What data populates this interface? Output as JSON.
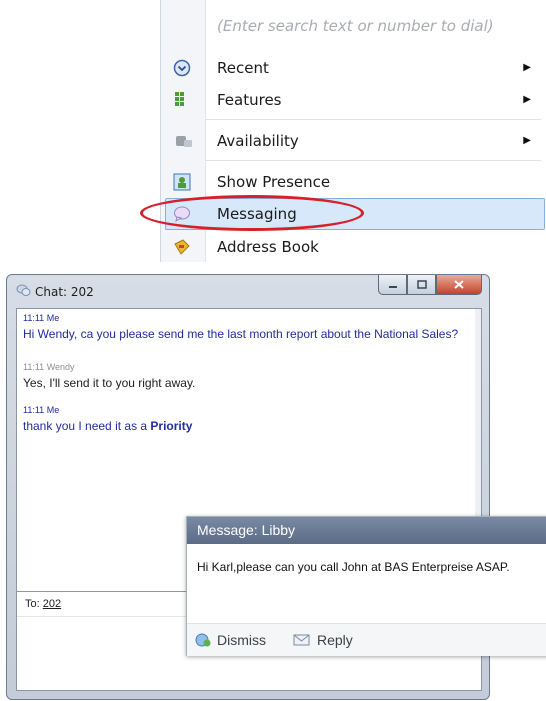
{
  "menu": {
    "search_placeholder": "(Enter search text or number to dial)",
    "items": [
      {
        "label": "Recent",
        "icon": "clock-icon",
        "submenu": "▶"
      },
      {
        "label": "Features",
        "icon": "grid-icon",
        "submenu": "▶"
      },
      {
        "label": "Availability",
        "icon": "availability-icon",
        "submenu": "▶"
      },
      {
        "label": "Show Presence",
        "icon": "presence-icon"
      },
      {
        "label": "Messaging",
        "icon": "message-bubble-icon",
        "highlighted": true
      },
      {
        "label": "Address Book",
        "icon": "address-book-icon"
      }
    ],
    "highlight_color": "#d7e8fb",
    "annotation_color": "#d8202a"
  },
  "chat": {
    "title": "Chat: 202",
    "messages": [
      {
        "time": "11:11",
        "sender": "Me",
        "text": "Hi Wendy, ca you please send me the last month report about the National Sales?"
      },
      {
        "time": "11:11",
        "sender": "Wendy",
        "text": "Yes, I'll send it to you right away."
      },
      {
        "time": "11:11",
        "sender": "Me",
        "text": "thank you I need it as a ",
        "bold": "Priority"
      }
    ],
    "to_label": "To:",
    "to_value": "202"
  },
  "toast": {
    "title": "Message: Libby",
    "body": "Hi Karl,please can you call John at BAS Enterpreise ASAP.",
    "dismiss_label": "Dismiss",
    "reply_label": "Reply"
  }
}
